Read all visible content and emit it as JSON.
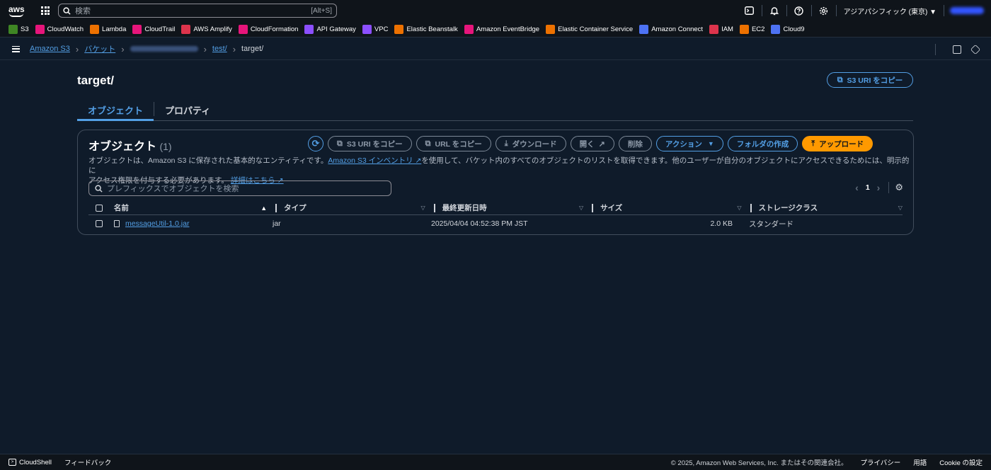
{
  "topbar": {
    "logo": "aws",
    "search_placeholder": "検索",
    "search_shortcut": "[Alt+S]",
    "region": "アジアパシフィック (東京) ▼"
  },
  "favorites": [
    {
      "label": "S3",
      "color": "#3f8624"
    },
    {
      "label": "CloudWatch",
      "color": "#e7157b"
    },
    {
      "label": "Lambda",
      "color": "#ed7100"
    },
    {
      "label": "CloudTrail",
      "color": "#e7157b"
    },
    {
      "label": "AWS Amplify",
      "color": "#dd344c"
    },
    {
      "label": "CloudFormation",
      "color": "#e7157b"
    },
    {
      "label": "API Gateway",
      "color": "#8c4fff"
    },
    {
      "label": "VPC",
      "color": "#8c4fff"
    },
    {
      "label": "Elastic Beanstalk",
      "color": "#ed7100"
    },
    {
      "label": "Amazon EventBridge",
      "color": "#e7157b"
    },
    {
      "label": "Elastic Container Service",
      "color": "#ed7100"
    },
    {
      "label": "Amazon Connect",
      "color": "#4d72f3"
    },
    {
      "label": "IAM",
      "color": "#dd344c"
    },
    {
      "label": "EC2",
      "color": "#ed7100"
    },
    {
      "label": "Cloud9",
      "color": "#4d72f3"
    }
  ],
  "breadcrumb": {
    "s3": "Amazon S3",
    "buckets": "バケット",
    "folder": "test/",
    "current": "target/"
  },
  "page": {
    "title": "target/",
    "copy_uri": "S3 URI をコピー",
    "tabs": [
      "オブジェクト",
      "プロパティ"
    ]
  },
  "objects": {
    "title": "オブジェクト",
    "count": "(1)",
    "actions": {
      "copy_s3_uri": "S3 URI をコピー",
      "copy_url": "URL をコピー",
      "download": "ダウンロード",
      "open": "開く",
      "delete": "削除",
      "actions": "アクション",
      "create_folder": "フォルダの作成",
      "upload": "アップロード"
    },
    "desc_1": "オブジェクトは、Amazon S3 に保存された基本的なエンティティです。",
    "desc_link": "Amazon S3 インベントリ",
    "desc_2": "を使用して、バケット内のすべてのオブジェクトのリストを取得できます。他のユーザーが自分のオブジェクトにアクセスできるためには、明示的に",
    "desc_3": "アクセス権限を付与する必要があります。",
    "desc_more": "詳細はこちら",
    "filter_placeholder": "プレフィックスでオブジェクトを検索",
    "page_number": "1",
    "columns": [
      "名前",
      "タイプ",
      "最終更新日時",
      "サイズ",
      "ストレージクラス"
    ],
    "rows": [
      {
        "name": "messageUtil-1.0.jar",
        "type": "jar",
        "modified": "2025/04/04 04:52:38 PM JST",
        "size": "2.0 KB",
        "storage": "スタンダード"
      }
    ]
  },
  "footer": {
    "cloudshell": "CloudShell",
    "feedback": "フィードバック",
    "copyright": "© 2025, Amazon Web Services, Inc. またはその関連会社。",
    "privacy": "プライバシー",
    "terms": "用語",
    "cookie": "Cookie の設定"
  }
}
